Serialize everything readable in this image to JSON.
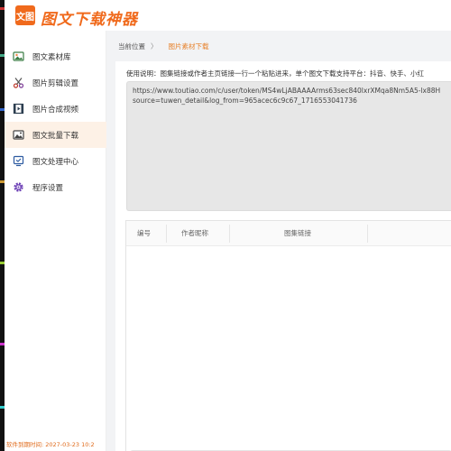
{
  "app": {
    "logo_text": "文图",
    "title": "图文下载神器"
  },
  "sidebar": {
    "items": [
      {
        "label": "图文素材库",
        "icon": "image-library-icon",
        "active": false
      },
      {
        "label": "图片剪辑设置",
        "icon": "scissors-icon",
        "active": false
      },
      {
        "label": "图片合成视频",
        "icon": "video-compose-icon",
        "active": false
      },
      {
        "label": "图文批量下载",
        "icon": "batch-download-icon",
        "active": true
      },
      {
        "label": "图文处理中心",
        "icon": "processing-center-icon",
        "active": false
      },
      {
        "label": "程序设置",
        "icon": "gear-icon",
        "active": false
      }
    ],
    "expiry_text": "软件到期时间: 2027-03-23 10:2"
  },
  "breadcrumb": {
    "home": "当前位置",
    "separator": "〉",
    "current": "图片素材下载"
  },
  "main": {
    "usage_text": "使用说明：图集链接或作者主页链接一行一个粘贴进来，单个图文下载支持平台：抖音、快手、小红",
    "link_input_value": "https://www.toutiao.com/c/user/token/MS4wLjABAAAArms63sec840lxrXMqa8Nm5A5-lx88H\nsource=tuwen_detail&log_from=965acec6c9c67_1716553041736"
  },
  "table": {
    "columns": [
      "编号",
      "作者昵称",
      "图集链接"
    ]
  },
  "colors": {
    "accent": "#f06a1c",
    "active_bg": "#fdf1e6",
    "crumb_current": "#e7812a"
  }
}
